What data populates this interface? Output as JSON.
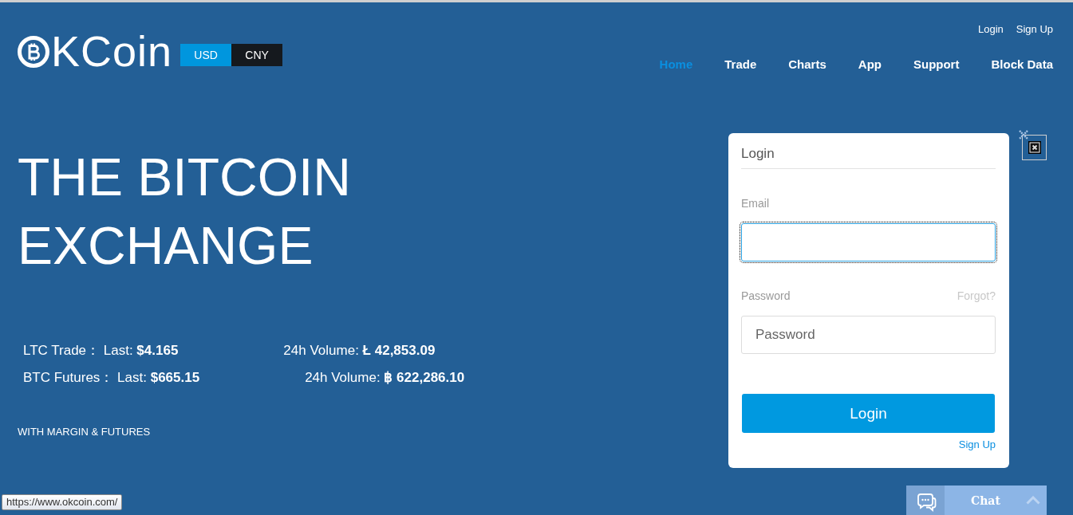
{
  "header": {
    "logo": "KCoin",
    "currencies": [
      {
        "label": "USD",
        "selected": true
      },
      {
        "label": "CNY",
        "selected": false
      }
    ],
    "account_links": [
      "Login",
      "Sign Up"
    ],
    "nav": [
      {
        "label": "Home",
        "selected": true
      },
      {
        "label": "Trade",
        "selected": false
      },
      {
        "label": "Charts",
        "selected": false
      },
      {
        "label": "App",
        "selected": false
      },
      {
        "label": "Support",
        "selected": false
      },
      {
        "label": "Block Data",
        "selected": false
      }
    ]
  },
  "hero": {
    "title": "THE BITCOIN EXCHANGE",
    "markets": [
      {
        "last": "LTC Trade： Last: **$4.165**",
        "volume": "24h Volume: **Ł 42,853.09**"
      },
      {
        "last": "BTC Futures： Last: **$665.15**",
        "volume": "24h Volume: **฿ 622,286.10**"
      }
    ],
    "tagline": "WITH MARGIN & FUTURES"
  },
  "login_form": {
    "title": "Login",
    "email_label": "Email",
    "email_focused": true,
    "password_label": "Password",
    "forgot": "Forgot?",
    "password_placeholder": "Password",
    "submit": "Login",
    "signup": "Sign Up"
  },
  "chat": {
    "label": "Chat"
  },
  "status_url": "https://www.okcoin.com/"
}
